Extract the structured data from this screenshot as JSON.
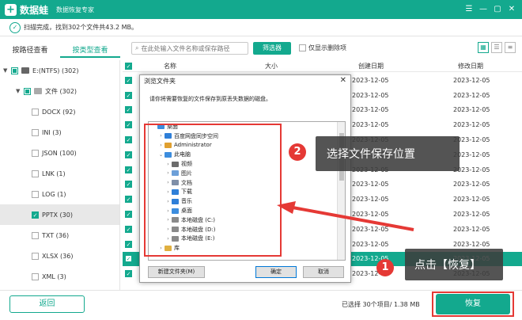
{
  "app": {
    "logo_text": "数据蛙",
    "subtitle": "数据恢复专家",
    "controls": [
      "☰",
      "—",
      "▢",
      "✕"
    ]
  },
  "status": {
    "text": "扫描完成，找到302个文件共43.2 MB。"
  },
  "tabs": [
    "按路径查看",
    "按类型查看"
  ],
  "search": {
    "placeholder": "在此处输入文件名称或保存路径"
  },
  "filter_label": "筛选器",
  "show_deleted_label": "仅显示删除项",
  "tree": [
    {
      "label": "E:(NTFS) (302)",
      "level": 0,
      "check": "partial",
      "arrow": "▼"
    },
    {
      "label": "文件 (302)",
      "level": 1,
      "check": "partial",
      "arrow": "▼"
    },
    {
      "label": "DOCX (92)",
      "level": 2,
      "check": "off"
    },
    {
      "label": "INI (3)",
      "level": 2,
      "check": "off"
    },
    {
      "label": "JSON (100)",
      "level": 2,
      "check": "off"
    },
    {
      "label": "LNK (1)",
      "level": 2,
      "check": "off"
    },
    {
      "label": "LOG (1)",
      "level": 2,
      "check": "off"
    },
    {
      "label": "PPTX (30)",
      "level": 2,
      "check": "on",
      "selected": true
    },
    {
      "label": "TXT (36)",
      "level": 2,
      "check": "off"
    },
    {
      "label": "XLSX (36)",
      "level": 2,
      "check": "off"
    },
    {
      "label": "XML (3)",
      "level": 2,
      "check": "off"
    }
  ],
  "file_header": {
    "name": "名称",
    "size": "大小",
    "created": "创建日期",
    "modified": "修改日期"
  },
  "file_date": "2023-12-05",
  "file_row_count": 14,
  "highlight_row_index": 12,
  "dialog": {
    "title": "浏览文件夹",
    "message": "请你将需要恢复的文件保存到原丢失数据的磁盘。",
    "nodes": [
      {
        "label": "桌面",
        "indent": 0,
        "ex": "",
        "color": "#3c8dde"
      },
      {
        "label": "百度网盘同步空间",
        "indent": 1,
        "ex": "›",
        "color": "#2f7fd8"
      },
      {
        "label": "Administrator",
        "indent": 1,
        "ex": "›",
        "color": "#e0a030"
      },
      {
        "label": "此电脑",
        "indent": 1,
        "ex": "⌄",
        "color": "#3c8dde"
      },
      {
        "label": "视频",
        "indent": 2,
        "ex": "›",
        "color": "#6c6c6c"
      },
      {
        "label": "图片",
        "indent": 2,
        "ex": "›",
        "color": "#6c9fd8"
      },
      {
        "label": "文档",
        "indent": 2,
        "ex": "›",
        "color": "#7f8fa8"
      },
      {
        "label": "下载",
        "indent": 2,
        "ex": "›",
        "color": "#2f7fd8"
      },
      {
        "label": "音乐",
        "indent": 2,
        "ex": "›",
        "color": "#2f7fd8"
      },
      {
        "label": "桌面",
        "indent": 2,
        "ex": "›",
        "color": "#3c8dde"
      },
      {
        "label": "本地磁盘 (C:)",
        "indent": 2,
        "ex": "›",
        "color": "#8a8a8a"
      },
      {
        "label": "本地磁盘 (D:)",
        "indent": 2,
        "ex": "›",
        "color": "#8a8a8a"
      },
      {
        "label": "本地磁盘 (E:)",
        "indent": 2,
        "ex": "›",
        "color": "#8a8a8a"
      },
      {
        "label": "库",
        "indent": 1,
        "ex": "›",
        "color": "#e0b040"
      }
    ],
    "new_folder": "新建文件夹(M)",
    "ok": "确定",
    "cancel": "取消"
  },
  "callout1": {
    "num": "1",
    "text": "点击【恢复】"
  },
  "callout2": {
    "num": "2",
    "text": "选择文件保存位置"
  },
  "bottom": {
    "back": "返回",
    "selected_info": "已选择 30个项目/ 1.38 MB",
    "recover": "恢复"
  }
}
